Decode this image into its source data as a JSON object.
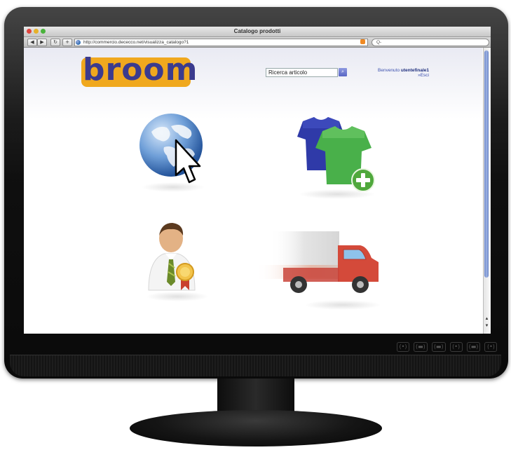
{
  "window": {
    "title": "Catalogo prodotti",
    "url": "http://commercio.dececco.net/visualizza_catalogo?1",
    "search_placeholder": "Q-"
  },
  "toolbar": {
    "back_icon": "back-arrow-icon",
    "forward_icon": "forward-arrow-icon",
    "reload_icon": "reload-icon",
    "add_icon": "plus-icon"
  },
  "page": {
    "logo_text": "broom",
    "search_value": "Ricerca articolo",
    "welcome_prefix": "Benvenuto",
    "user_name": "utentefinale1",
    "exit_label": "»Esci"
  },
  "tiles": [
    {
      "name": "catalog-globe",
      "icon": "globe-icon"
    },
    {
      "name": "products-add",
      "icon": "tshirt-add-icon"
    },
    {
      "name": "account-profile",
      "icon": "businessman-badge-icon"
    },
    {
      "name": "shipping-delivery",
      "icon": "delivery-truck-icon"
    }
  ],
  "monitor": {
    "controls": [
      "(•)",
      "(▬)",
      "(▬)",
      "(•)",
      "(▬)",
      "(•)"
    ]
  },
  "colors": {
    "logo_bg": "#f0a81e",
    "logo_text": "#3b3b8e",
    "link": "#3b4fae"
  }
}
